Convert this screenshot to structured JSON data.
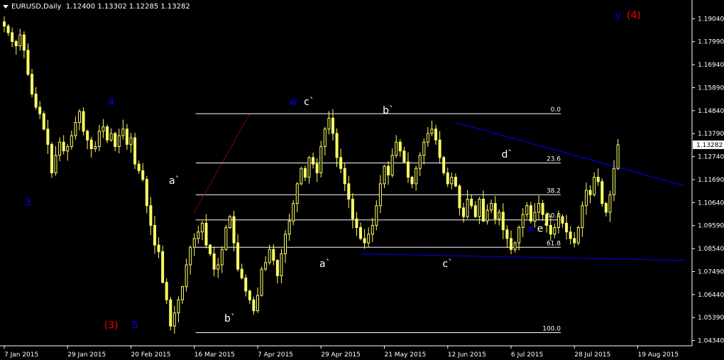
{
  "header": {
    "symbol": "EURUSD,Daily",
    "ohlc": "1.12400 1.13302 1.12285 1.13282"
  },
  "colors": {
    "background": "#000000",
    "axis": "#ffffff",
    "candle": "#ffff66",
    "fib_line": "#ffffff",
    "trendline": "#0000ff",
    "dotted_line": "#ff0000",
    "wave_blue": "#0000ff",
    "wave_red": "#ff0000",
    "wave_white": "#ffffff"
  },
  "chart_data": {
    "type": "candlestick",
    "y_range": [
      1.041,
      1.197
    ],
    "y_ticks": [
      "1.19040",
      "1.17990",
      "1.16940",
      "1.15890",
      "1.14840",
      "1.13790",
      "1.12740",
      "1.11690",
      "1.10640",
      "1.09590",
      "1.08540",
      "1.07490",
      "1.06440",
      "1.05390",
      "1.04340"
    ],
    "current_price": "1.13282",
    "x_ticks": [
      {
        "label": "7 Jan 2015",
        "day": 0
      },
      {
        "label": "29 Jan 2015",
        "day": 16
      },
      {
        "label": "20 Feb 2015",
        "day": 32
      },
      {
        "label": "16 Mar 2015",
        "day": 48
      },
      {
        "label": "7 Apr 2015",
        "day": 64
      },
      {
        "label": "29 Apr 2015",
        "day": 80
      },
      {
        "label": "21 May 2015",
        "day": 96
      },
      {
        "label": "12 Jun 2015",
        "day": 112
      },
      {
        "label": "6 Jul 2015",
        "day": 128
      },
      {
        "label": "28 Jul 2015",
        "day": 144
      },
      {
        "label": "19 Aug 2015",
        "day": 160
      }
    ],
    "x_range": [
      0,
      173
    ],
    "closes": [
      1.187,
      1.184,
      1.18,
      1.178,
      1.183,
      1.176,
      1.165,
      1.156,
      1.15,
      1.147,
      1.14,
      1.133,
      1.12,
      1.128,
      1.134,
      1.13,
      1.132,
      1.137,
      1.143,
      1.148,
      1.139,
      1.135,
      1.131,
      1.132,
      1.139,
      1.141,
      1.135,
      1.138,
      1.132,
      1.137,
      1.14,
      1.133,
      1.136,
      1.124,
      1.121,
      1.117,
      1.105,
      1.096,
      1.087,
      1.084,
      1.07,
      1.062,
      1.05,
      1.056,
      1.062,
      1.068,
      1.078,
      1.086,
      1.09,
      1.093,
      1.097,
      1.087,
      1.083,
      1.076,
      1.078,
      1.085,
      1.095,
      1.1,
      1.088,
      1.076,
      1.072,
      1.066,
      1.062,
      1.057,
      1.064,
      1.076,
      1.079,
      1.085,
      1.08,
      1.073,
      1.083,
      1.092,
      1.098,
      1.106,
      1.115,
      1.122,
      1.118,
      1.127,
      1.124,
      1.12,
      1.132,
      1.14,
      1.145,
      1.138,
      1.127,
      1.122,
      1.115,
      1.108,
      1.099,
      1.095,
      1.09,
      1.088,
      1.092,
      1.096,
      1.105,
      1.115,
      1.123,
      1.119,
      1.128,
      1.134,
      1.13,
      1.125,
      1.118,
      1.115,
      1.122,
      1.128,
      1.134,
      1.138,
      1.14,
      1.135,
      1.127,
      1.12,
      1.115,
      1.118,
      1.114,
      1.104,
      1.1,
      1.108,
      1.105,
      1.1,
      1.108,
      1.098,
      1.103,
      1.106,
      1.099,
      1.102,
      1.094,
      1.09,
      1.085,
      1.088,
      1.095,
      1.101,
      1.105,
      1.098,
      1.102,
      1.106,
      1.101,
      1.096,
      1.092,
      1.095,
      1.1,
      1.097,
      1.093,
      1.09,
      1.088,
      1.095,
      1.105,
      1.112,
      1.11,
      1.118,
      1.116,
      1.106,
      1.102,
      1.11,
      1.122,
      1.1328
    ],
    "fib_levels": [
      {
        "label": "0.0",
        "price": 1.147
      },
      {
        "label": "23.6",
        "price": 1.1245
      },
      {
        "label": "38.2",
        "price": 1.11
      },
      {
        "label": "50.0",
        "price": 1.0985
      },
      {
        "label": "61.8",
        "price": 1.086
      },
      {
        "label": "100.0",
        "price": 1.047
      }
    ],
    "trendlines": [
      {
        "name": "upper",
        "day1": 114,
        "p1": 1.143,
        "day2": 172,
        "p2": 1.114
      },
      {
        "name": "lower",
        "day1": 90,
        "p1": 1.083,
        "day2": 172,
        "p2": 1.08
      }
    ],
    "dotted_line": {
      "day1": 48,
      "p1": 1.102,
      "day2": 62,
      "p2": 1.147
    },
    "wave_labels": [
      {
        "text": "y",
        "day": 155,
        "price": 1.1905,
        "color": "blue"
      },
      {
        "text": "(4)",
        "day": 159,
        "price": 1.1905,
        "color": "red"
      },
      {
        "text": "4",
        "day": 27,
        "price": 1.151,
        "color": "blue"
      },
      {
        "text": "3",
        "day": 6,
        "price": 1.105,
        "color": "blue"
      },
      {
        "text": "(3)",
        "day": 27,
        "price": 1.049,
        "color": "red"
      },
      {
        "text": "5",
        "day": 33,
        "price": 1.049,
        "color": "blue"
      },
      {
        "text": "w",
        "day": 73,
        "price": 1.151,
        "color": "blue"
      },
      {
        "text": "c`",
        "day": 77,
        "price": 1.151,
        "color": "white"
      },
      {
        "text": "b`",
        "day": 97,
        "price": 1.147,
        "color": "white"
      },
      {
        "text": "a`",
        "day": 43,
        "price": 1.115,
        "color": "white"
      },
      {
        "text": "a`",
        "day": 81,
        "price": 1.077,
        "color": "white"
      },
      {
        "text": "b`",
        "day": 57,
        "price": 1.052,
        "color": "white"
      },
      {
        "text": "c`",
        "day": 112,
        "price": 1.077,
        "color": "white"
      },
      {
        "text": "d`",
        "day": 127,
        "price": 1.127,
        "color": "white"
      },
      {
        "text": "x",
        "day": 133,
        "price": 1.093,
        "color": "blue"
      },
      {
        "text": "e`",
        "day": 136,
        "price": 1.093,
        "color": "white"
      }
    ]
  }
}
